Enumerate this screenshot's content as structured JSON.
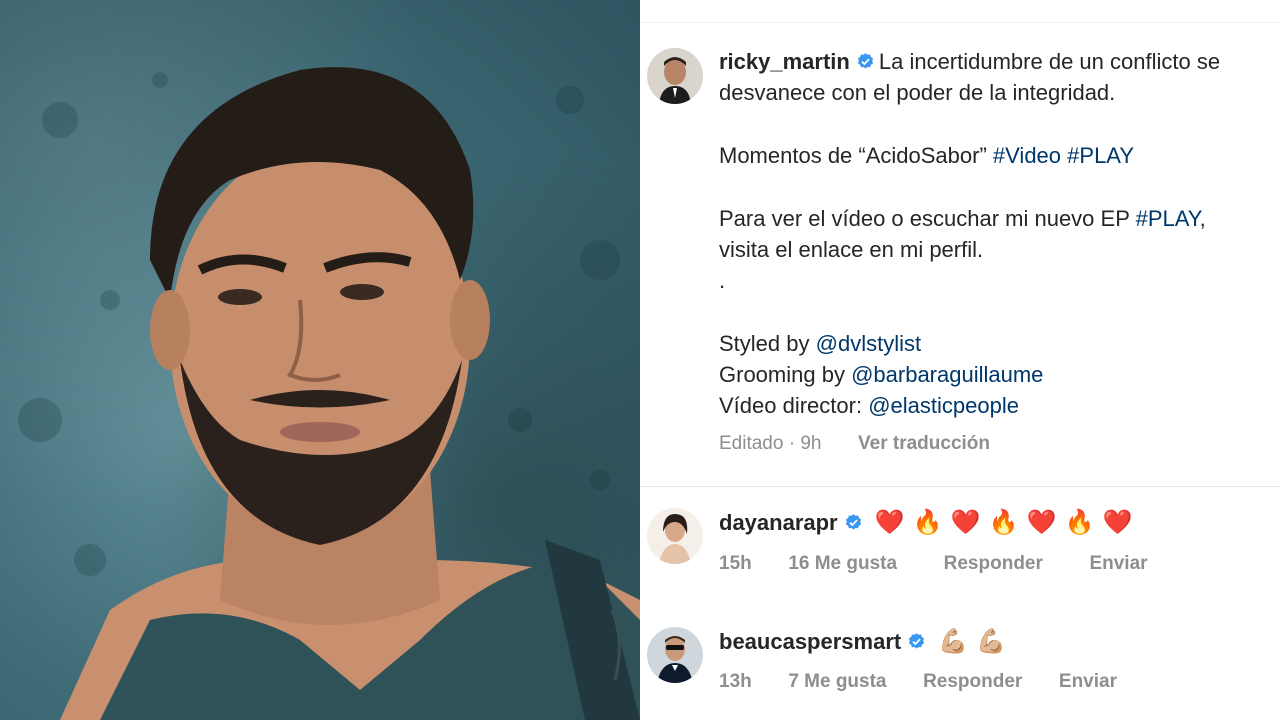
{
  "post": {
    "username": "ricky_martin",
    "caption_line1": "La incertidumbre de un conflicto se",
    "caption_line2": "desvanece con el poder de la integridad.",
    "moments_text": "Momentos de “AcidoSabor”",
    "hashtag_video": "#Video",
    "hashtag_play": "#PLAY",
    "watch_text": "Para ver el vídeo o escuchar mi nuevo EP",
    "watch_hashtag": "#PLAY",
    "watch_comma": ",",
    "visit_text": "visita el enlace en mi perfil.",
    "dot": ".",
    "styled_label": "Styled by",
    "styled_handle": "@dvlstylist",
    "grooming_label": "Grooming by",
    "grooming_handle": "@barbaraguillaume",
    "director_label": "Vídeo director:",
    "director_handle": "@elasticpeople",
    "edited": "Editado · 9h",
    "translate": "Ver traducción"
  },
  "comments": [
    {
      "username": "dayanarapr",
      "emojis": [
        "❤️",
        "🔥",
        "❤️",
        "🔥",
        "❤️",
        "🔥",
        "❤️"
      ],
      "time": "15h",
      "likes": "16 Me gusta",
      "reply": "Responder",
      "send": "Enviar"
    },
    {
      "username": "beaucaspersmart",
      "emojis": [
        "💪🏼",
        "💪🏼"
      ],
      "time": "13h",
      "likes": "7 Me gusta",
      "reply": "Responder",
      "send": "Enviar"
    }
  ],
  "colors": {
    "link": "#00376b",
    "verified": "#3897f0",
    "muted": "#8e8e8e",
    "text": "#262626"
  }
}
